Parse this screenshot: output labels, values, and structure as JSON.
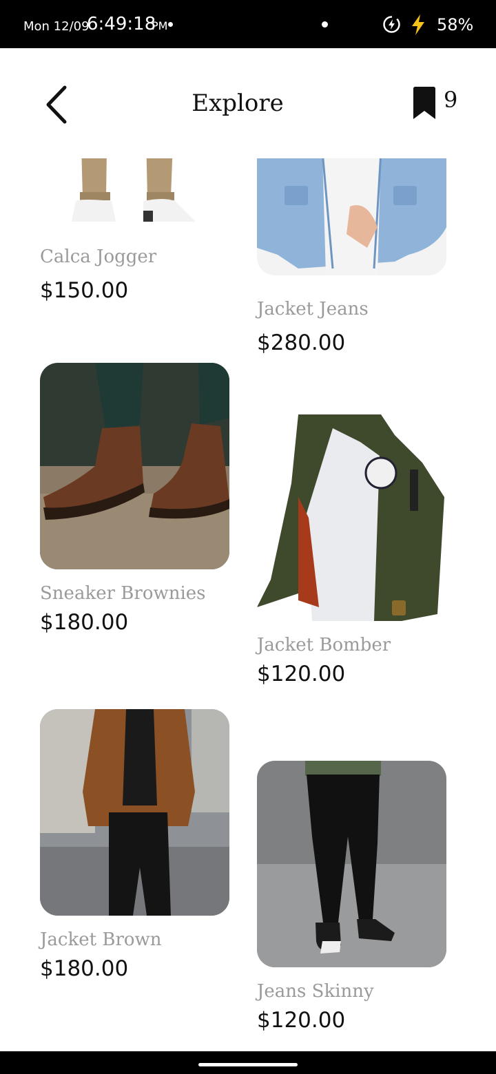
{
  "status_bar": {
    "date": "Mon 12/09",
    "time": "6:49:18",
    "ampm": "PM",
    "battery": "58%"
  },
  "header": {
    "title": "Explore",
    "bookmark_count": "9"
  },
  "products": [
    {
      "name": "Calca Jogger",
      "price": "$150.00"
    },
    {
      "name": "Jacket Jeans",
      "price": "$280.00"
    },
    {
      "name": "Sneaker Brownies",
      "price": "$180.00"
    },
    {
      "name": "Jacket Bomber",
      "price": "$120.00"
    },
    {
      "name": "Jacket Brown",
      "price": "$180.00"
    },
    {
      "name": "Jeans Skinny",
      "price": "$120.00"
    }
  ],
  "colors": {
    "text_primary": "#111111",
    "text_secondary": "#9a9a9a",
    "background": "#ffffff"
  }
}
